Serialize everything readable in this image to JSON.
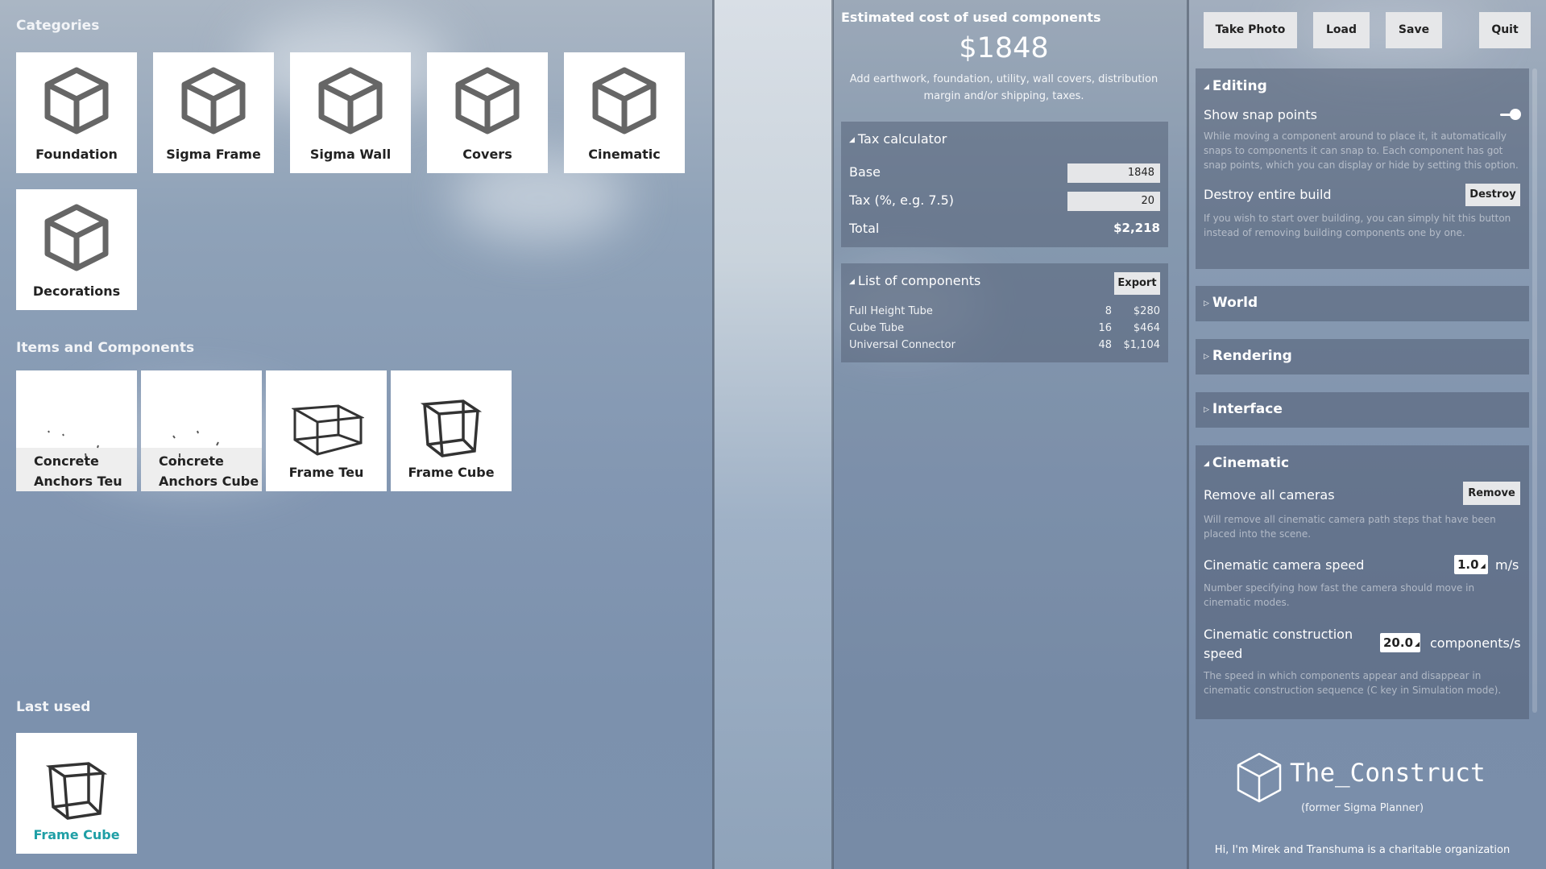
{
  "categories": {
    "title": "Categories",
    "items": [
      "Foundation",
      "Sigma Frame",
      "Sigma Wall",
      "Covers",
      "Cinematic",
      "Decorations"
    ]
  },
  "items_components": {
    "title": "Items and Components",
    "items": [
      {
        "line1": "Concrete",
        "line2": "Anchors Teu"
      },
      {
        "line1": "Concrete",
        "line2": "Anchors Cube"
      },
      {
        "line1": "Frame Teu",
        "line2": ""
      },
      {
        "line1": "Frame Cube",
        "line2": ""
      }
    ]
  },
  "last_used": {
    "title": "Last used",
    "item": "Frame Cube"
  },
  "estimate": {
    "title": "Estimated cost of used components",
    "amount": "$1848",
    "note_line1": "Add earthwork, foundation, utility, wall covers, distribution",
    "note_line2": "margin and/or shipping, taxes."
  },
  "tax_calculator": {
    "title": "Tax calculator",
    "base_label": "Base",
    "base_value": "1848",
    "tax_label": "Tax (%, e.g. 7.5)",
    "tax_value": "20",
    "total_label": "Total",
    "total_value": "$2,218"
  },
  "components_list": {
    "title": "List of components",
    "export_label": "Export",
    "rows": [
      {
        "name": "Full Height Tube",
        "qty": "8",
        "price": "$280"
      },
      {
        "name": "Cube Tube",
        "qty": "16",
        "price": "$464"
      },
      {
        "name": "Universal Connector",
        "qty": "48",
        "price": "$1,104"
      }
    ]
  },
  "toolbar": {
    "take_photo": "Take Photo",
    "load": "Load",
    "save": "Save",
    "quit": "Quit"
  },
  "editing": {
    "title": "Editing",
    "snap_label": "Show snap points",
    "snap_on": true,
    "snap_desc": "While moving a component around to place it, it automatically snaps to components it can snap to. Each component has got snap points, which you can display or hide by setting this option.",
    "destroy_label": "Destroy entire build",
    "destroy_button": "Destroy",
    "destroy_desc": "If you wish to start over building, you can simply hit this button instead of removing building components one by one."
  },
  "sections": {
    "world": "World",
    "rendering": "Rendering",
    "interface": "Interface"
  },
  "cinematic": {
    "title": "Cinematic",
    "remove_label": "Remove all cameras",
    "remove_button": "Remove",
    "remove_desc": "Will remove all cinematic camera path steps that have been placed into the scene.",
    "camera_speed_label": "Cinematic camera speed",
    "camera_speed_value": "1.0",
    "camera_speed_unit": "m/s",
    "camera_speed_desc": "Number specifying how fast the camera should move in cinematic modes.",
    "construction_label_1": "Cinematic construction",
    "construction_label_2": "speed",
    "construction_value": "20.0",
    "construction_unit": "components/s",
    "construction_desc": "The speed in which components appear and disappear in cinematic construction sequence (C key in Simulation mode)."
  },
  "branding": {
    "name": "The_Construct",
    "subtitle": "(former Sigma Planner)",
    "footer": "Hi, I'm Mirek and Transhuma is a charitable organization"
  }
}
